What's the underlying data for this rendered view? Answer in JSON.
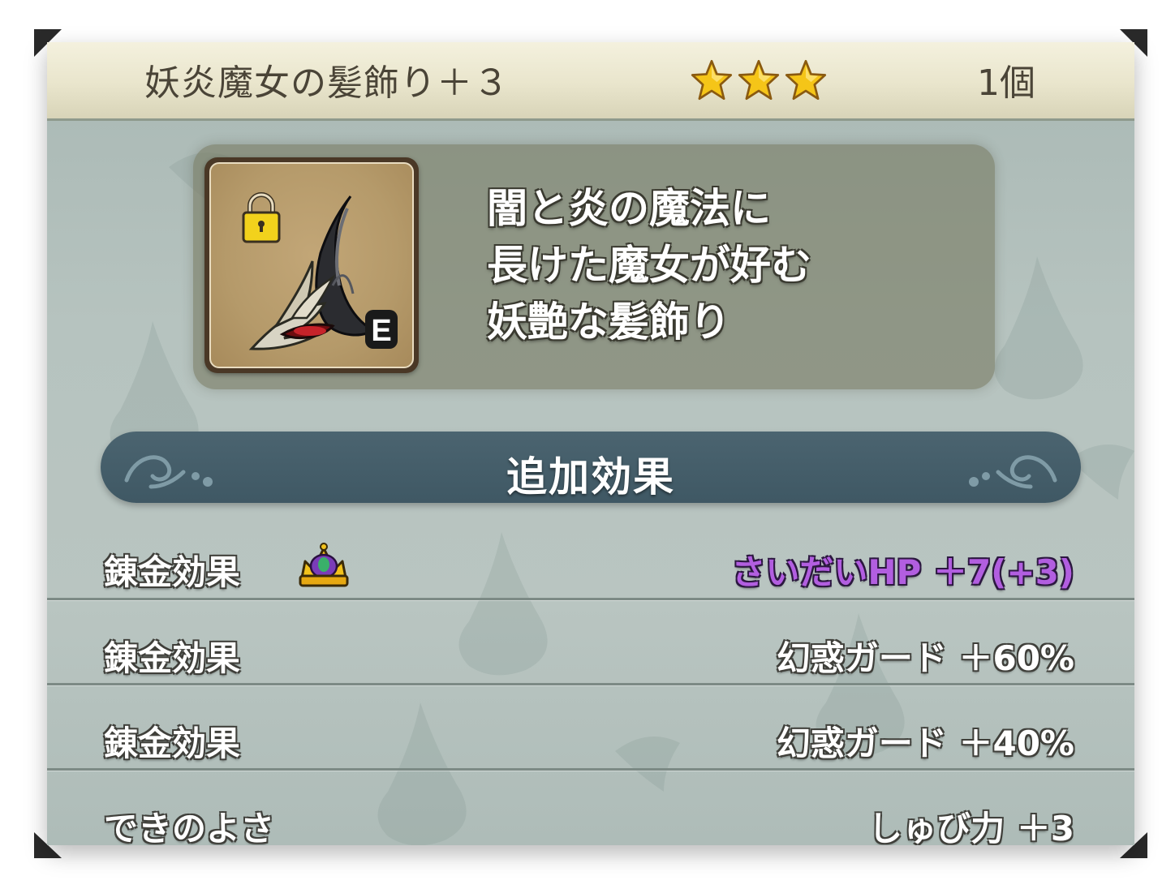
{
  "item": {
    "name": "妖炎魔女の髪飾り＋３",
    "rarity_stars": 3,
    "count": "1個",
    "description": "闇と炎の魔法に\n長けた魔女が好む\n妖艶な髪飾り",
    "icon": "witch-hair-ornament-icon",
    "lock_icon": "padlock-icon",
    "equipped_badge": "E"
  },
  "section": {
    "title": "追加効果"
  },
  "effects": [
    {
      "label": "錬金効果",
      "value": "さいだいHP ＋7(+3)",
      "special": true,
      "icon": "crown-icon"
    },
    {
      "label": "錬金効果",
      "value": "幻惑ガード ＋60%",
      "special": false
    },
    {
      "label": "錬金効果",
      "value": "幻惑ガード ＋40%",
      "special": false
    },
    {
      "label": "できのよさ",
      "value": "しゅび力 ＋3",
      "special": false
    }
  ],
  "colors": {
    "special_value": "#b25ee0",
    "star": "#f5c518",
    "section_bar": "#45606c"
  }
}
